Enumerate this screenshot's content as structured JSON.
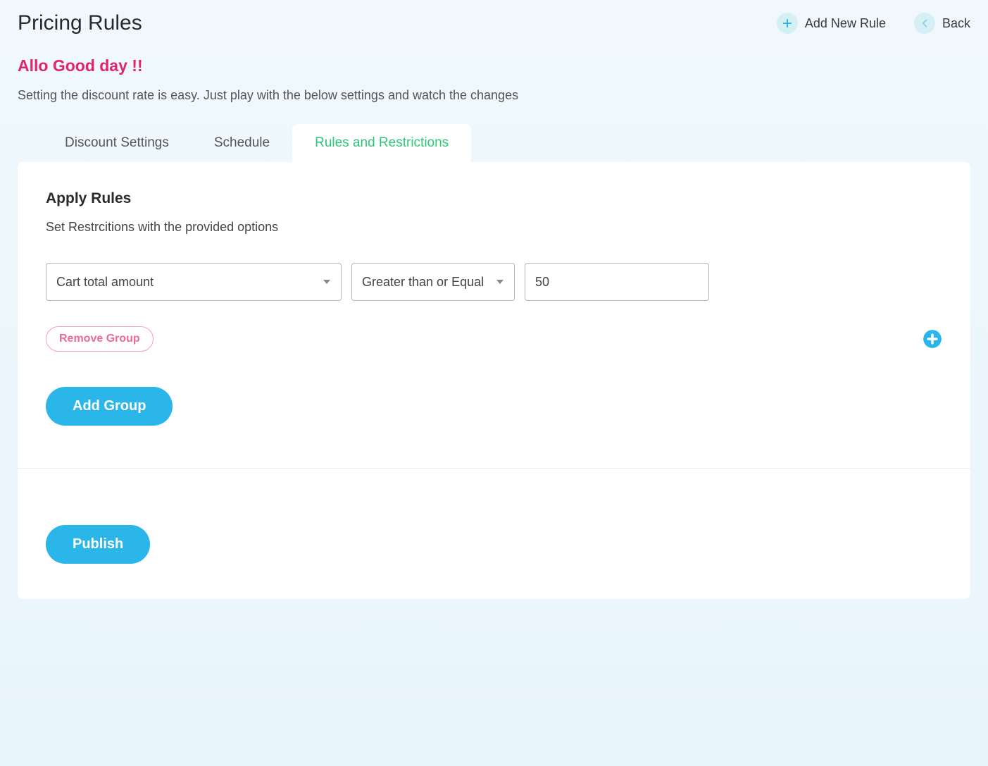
{
  "header": {
    "title": "Pricing Rules",
    "add_new_rule": "Add New Rule",
    "back": "Back"
  },
  "greeting": {
    "title": "Allo Good day !!",
    "description": "Setting the discount rate is easy. Just play with the below settings and watch the changes"
  },
  "tabs": [
    {
      "label": "Discount Settings"
    },
    {
      "label": "Schedule"
    },
    {
      "label": "Rules and Restrictions"
    }
  ],
  "apply_rules": {
    "title": "Apply Rules",
    "description": "Set Restrcitions with the provided options"
  },
  "rule": {
    "condition_field": "Cart total amount",
    "operator": "Greater than or Equal",
    "value": "50"
  },
  "buttons": {
    "remove_group": "Remove Group",
    "add_group": "Add Group",
    "publish": "Publish"
  }
}
